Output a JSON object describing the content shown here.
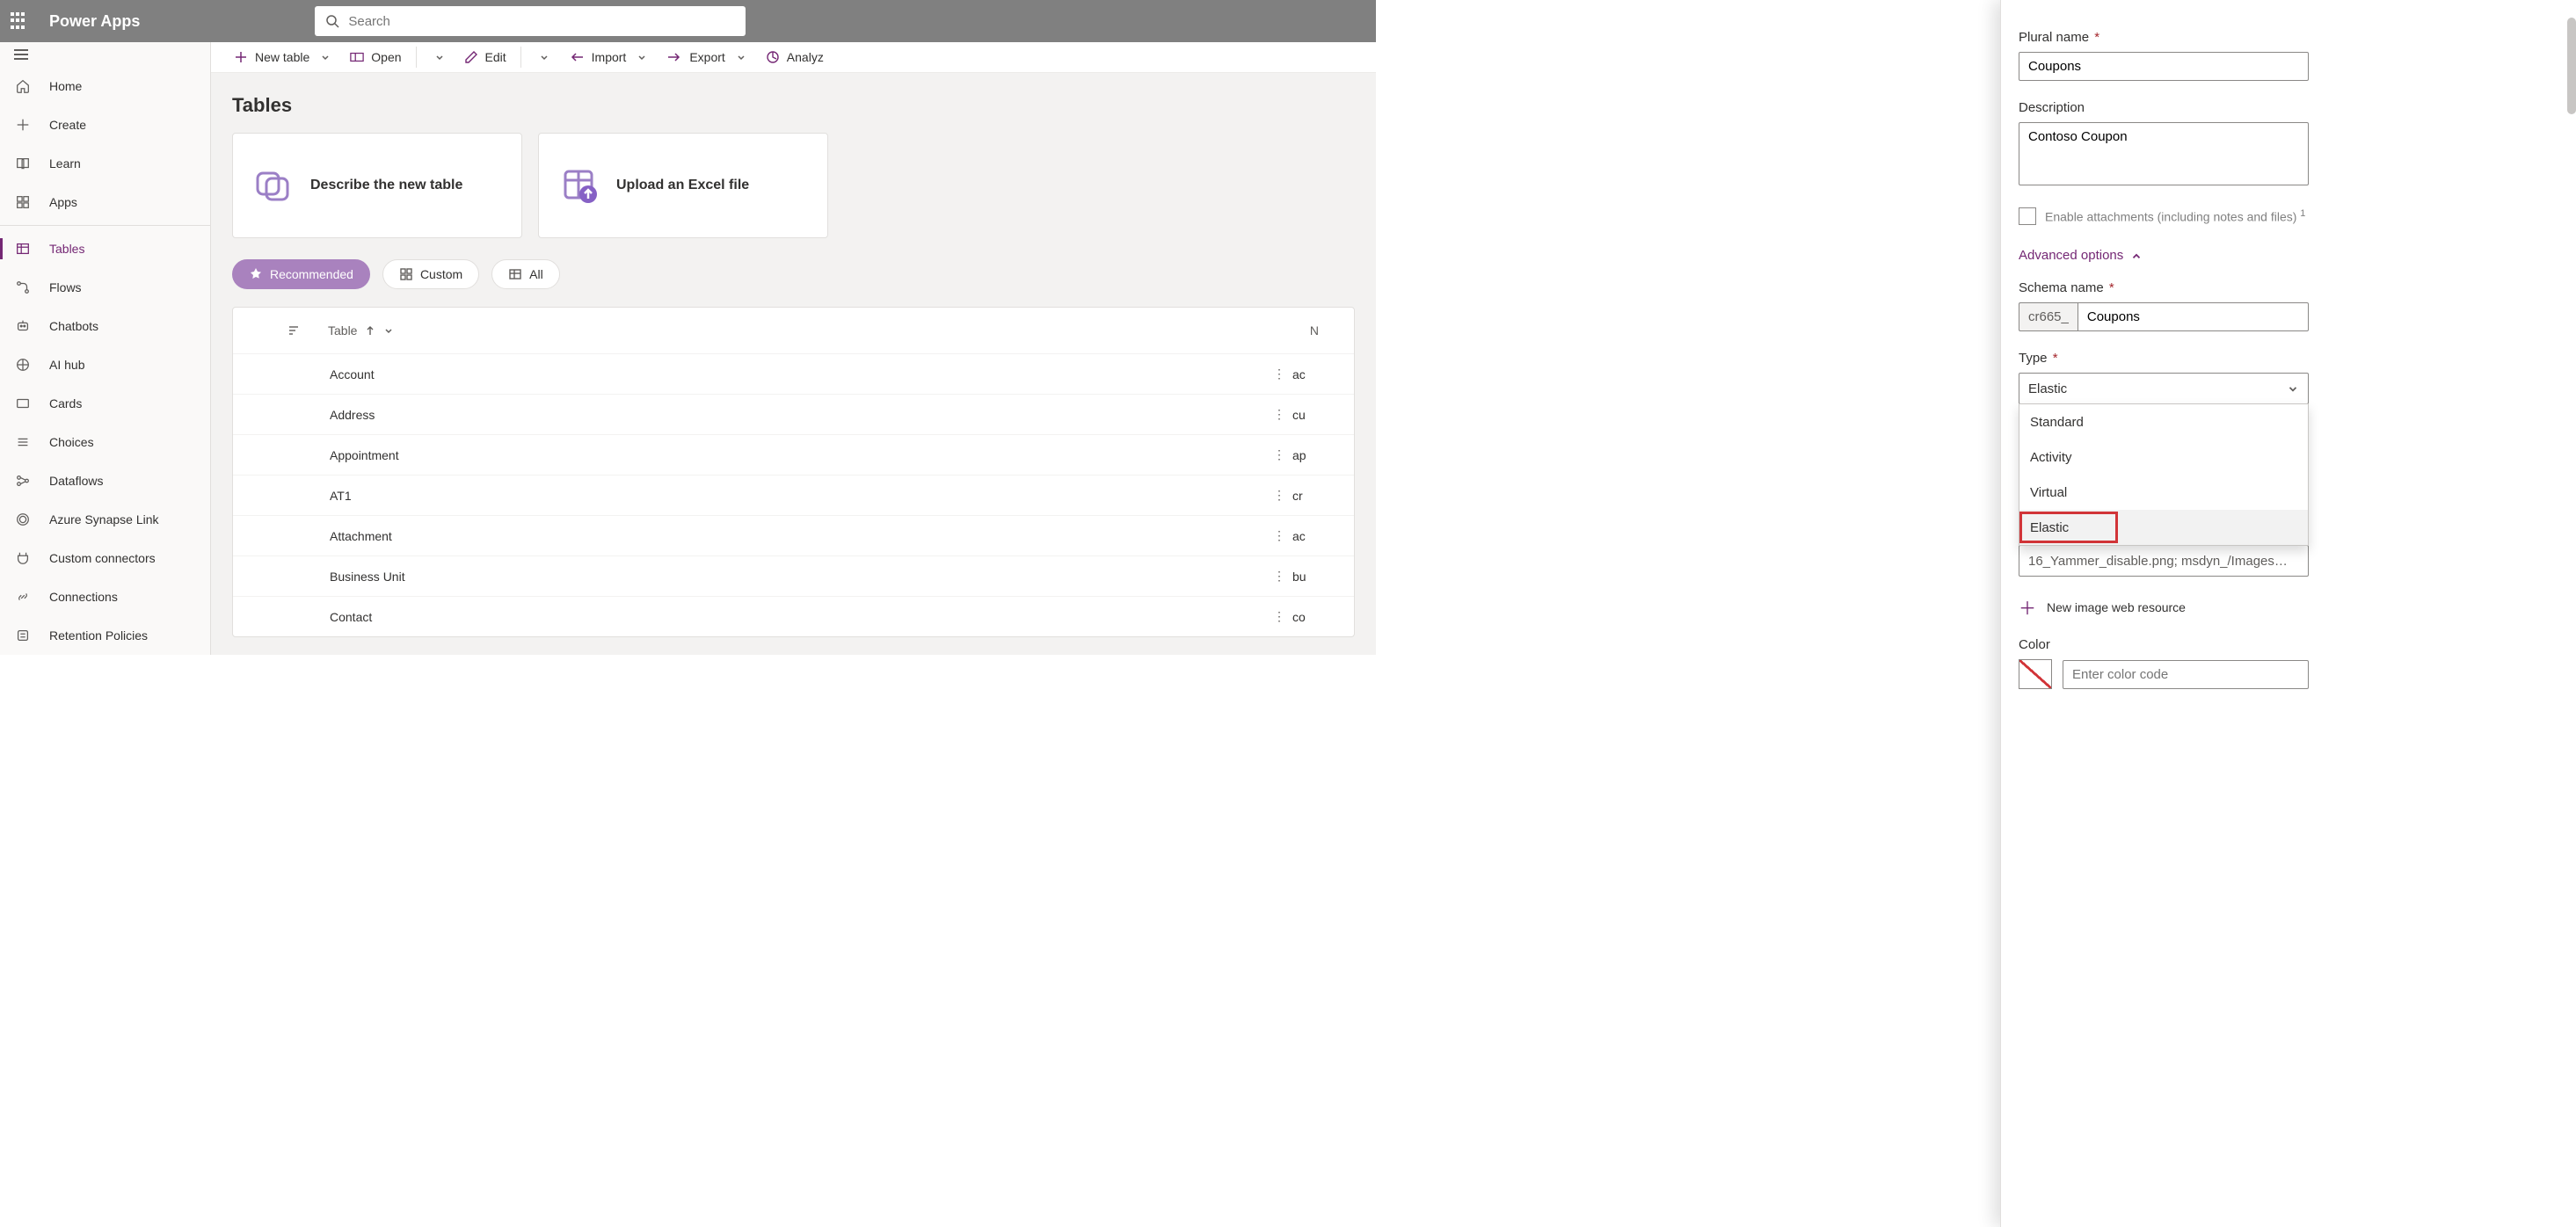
{
  "header": {
    "brand": "Power Apps",
    "search_placeholder": "Search"
  },
  "sidebar": {
    "items": [
      {
        "label": "Home"
      },
      {
        "label": "Create"
      },
      {
        "label": "Learn"
      },
      {
        "label": "Apps"
      },
      {
        "label": "Tables"
      },
      {
        "label": "Flows"
      },
      {
        "label": "Chatbots"
      },
      {
        "label": "AI hub"
      },
      {
        "label": "Cards"
      },
      {
        "label": "Choices"
      },
      {
        "label": "Dataflows"
      },
      {
        "label": "Azure Synapse Link"
      },
      {
        "label": "Custom connectors"
      },
      {
        "label": "Connections"
      },
      {
        "label": "Retention Policies"
      }
    ]
  },
  "toolbar": {
    "new_table": "New table",
    "open": "Open",
    "edit": "Edit",
    "import": "Import",
    "export": "Export",
    "analyze": "Analyz"
  },
  "page": {
    "title": "Tables",
    "card1": "Describe the new table",
    "card2": "Upload an Excel file",
    "filters": {
      "recommended": "Recommended",
      "custom": "Custom",
      "all": "All"
    },
    "grid_header_table": "Table",
    "grid_header_n": "N",
    "rows": [
      {
        "name": "Account",
        "col2": "ac"
      },
      {
        "name": "Address",
        "col2": "cu"
      },
      {
        "name": "Appointment",
        "col2": "ap"
      },
      {
        "name": "AT1",
        "col2": "cr"
      },
      {
        "name": "Attachment",
        "col2": "ac"
      },
      {
        "name": "Business Unit",
        "col2": "bu"
      },
      {
        "name": "Contact",
        "col2": "co"
      }
    ]
  },
  "panel": {
    "plural_name_label": "Plural name",
    "plural_name_value": "Coupons",
    "description_label": "Description",
    "description_value": "Contoso Coupon",
    "enable_attachments": "Enable attachments (including notes and files)",
    "advanced_options": "Advanced options",
    "schema_name_label": "Schema name",
    "schema_prefix": "cr665_",
    "schema_name_value": "Coupons",
    "type_label": "Type",
    "type_value": "Elastic",
    "type_options": [
      "Standard",
      "Activity",
      "Virtual",
      "Elastic"
    ],
    "truncated_row": "16_Yammer_disable.png; msdyn_/Images…",
    "new_image_link": "New image web resource",
    "color_label": "Color",
    "color_placeholder": "Enter color code"
  }
}
